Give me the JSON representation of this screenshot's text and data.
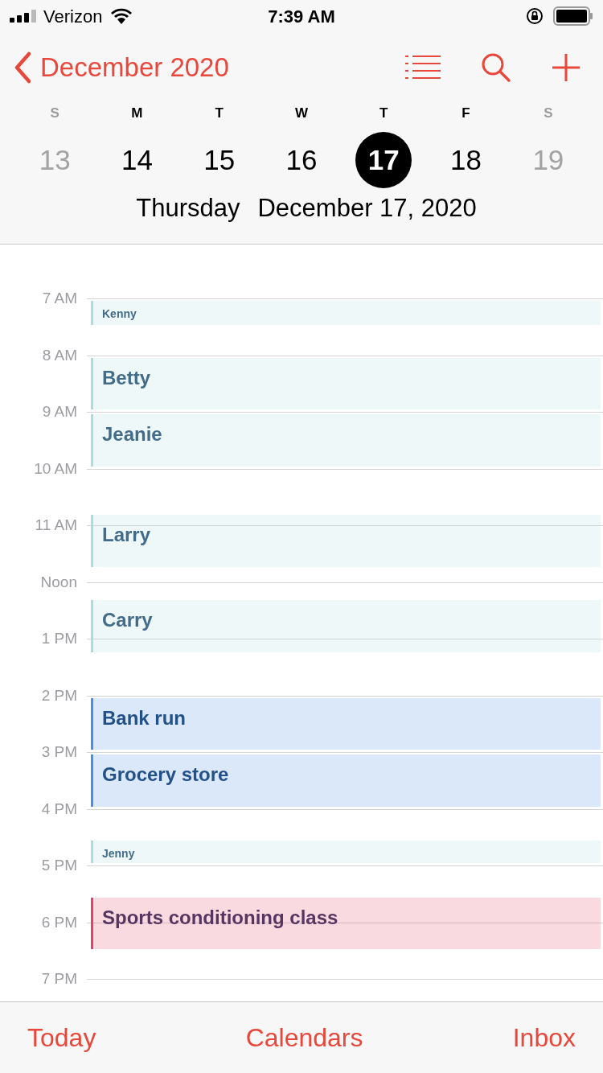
{
  "status_bar": {
    "carrier": "Verizon",
    "time": "7:39 AM"
  },
  "nav": {
    "title": "December 2020"
  },
  "week": [
    {
      "letter": "S",
      "number": "13",
      "weekend": true,
      "selected": false
    },
    {
      "letter": "M",
      "number": "14",
      "weekend": false,
      "selected": false
    },
    {
      "letter": "T",
      "number": "15",
      "weekend": false,
      "selected": false
    },
    {
      "letter": "W",
      "number": "16",
      "weekend": false,
      "selected": false
    },
    {
      "letter": "T",
      "number": "17",
      "weekend": false,
      "selected": true
    },
    {
      "letter": "F",
      "number": "18",
      "weekend": false,
      "selected": false
    },
    {
      "letter": "S",
      "number": "19",
      "weekend": true,
      "selected": false
    }
  ],
  "selected_date": {
    "weekday": "Thursday",
    "date": "December 17, 2020"
  },
  "hours": [
    "7 AM",
    "8 AM",
    "9 AM",
    "10 AM",
    "11 AM",
    "Noon",
    "1 PM",
    "2 PM",
    "3 PM",
    "4 PM",
    "5 PM",
    "6 PM",
    "7 PM"
  ],
  "events": [
    {
      "title": "Kenny",
      "kind": "short",
      "color": "#a8dde2"
    },
    {
      "title": "Betty",
      "kind": "normal",
      "color": "#a8dde2"
    },
    {
      "title": "Jeanie",
      "kind": "normal",
      "color": "#a8dde2"
    },
    {
      "title": "Larry",
      "kind": "normal",
      "color": "#a8dde2"
    },
    {
      "title": "Carry",
      "kind": "normal",
      "color": "#a8dde2"
    },
    {
      "title": "Bank run",
      "kind": "normal",
      "color": "#4a8ee0"
    },
    {
      "title": "Grocery store",
      "kind": "normal",
      "color": "#4a8ee0"
    },
    {
      "title": "Jenny",
      "kind": "short",
      "color": "#a8dde2"
    },
    {
      "title": "Sports conditioning class",
      "kind": "normal",
      "color": "#e0446b"
    }
  ],
  "tab_bar": [
    "Today",
    "Calendars",
    "Inbox"
  ]
}
